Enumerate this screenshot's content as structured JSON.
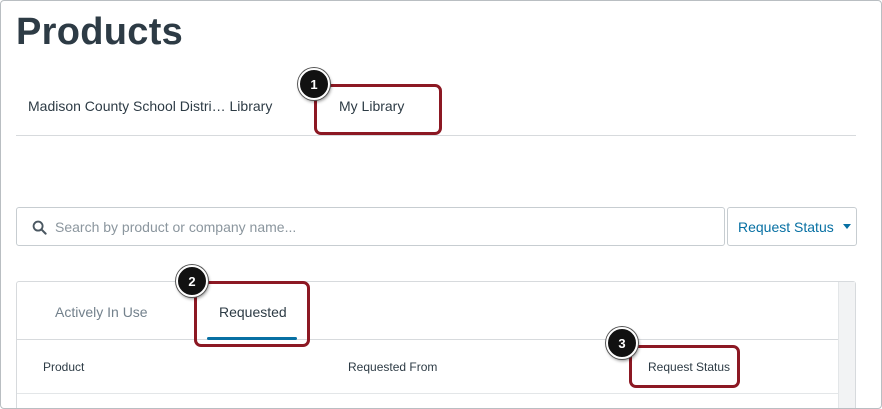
{
  "page": {
    "title": "Products"
  },
  "library_tabs": [
    {
      "label": "Madison County School Distri… Library"
    },
    {
      "label": "My Library"
    }
  ],
  "search": {
    "placeholder": "Search by product or company name...",
    "value": ""
  },
  "filter": {
    "label": "Request Status"
  },
  "product_tabs": [
    {
      "label": "Actively In Use"
    },
    {
      "label": "Requested"
    }
  ],
  "table": {
    "columns": [
      "Product",
      "Requested From",
      "Request Status"
    ]
  },
  "callouts": [
    "1",
    "2",
    "3"
  ],
  "colors": {
    "accent": "#0770a3",
    "callout": "#8c1823",
    "text": "#2d3b45"
  }
}
